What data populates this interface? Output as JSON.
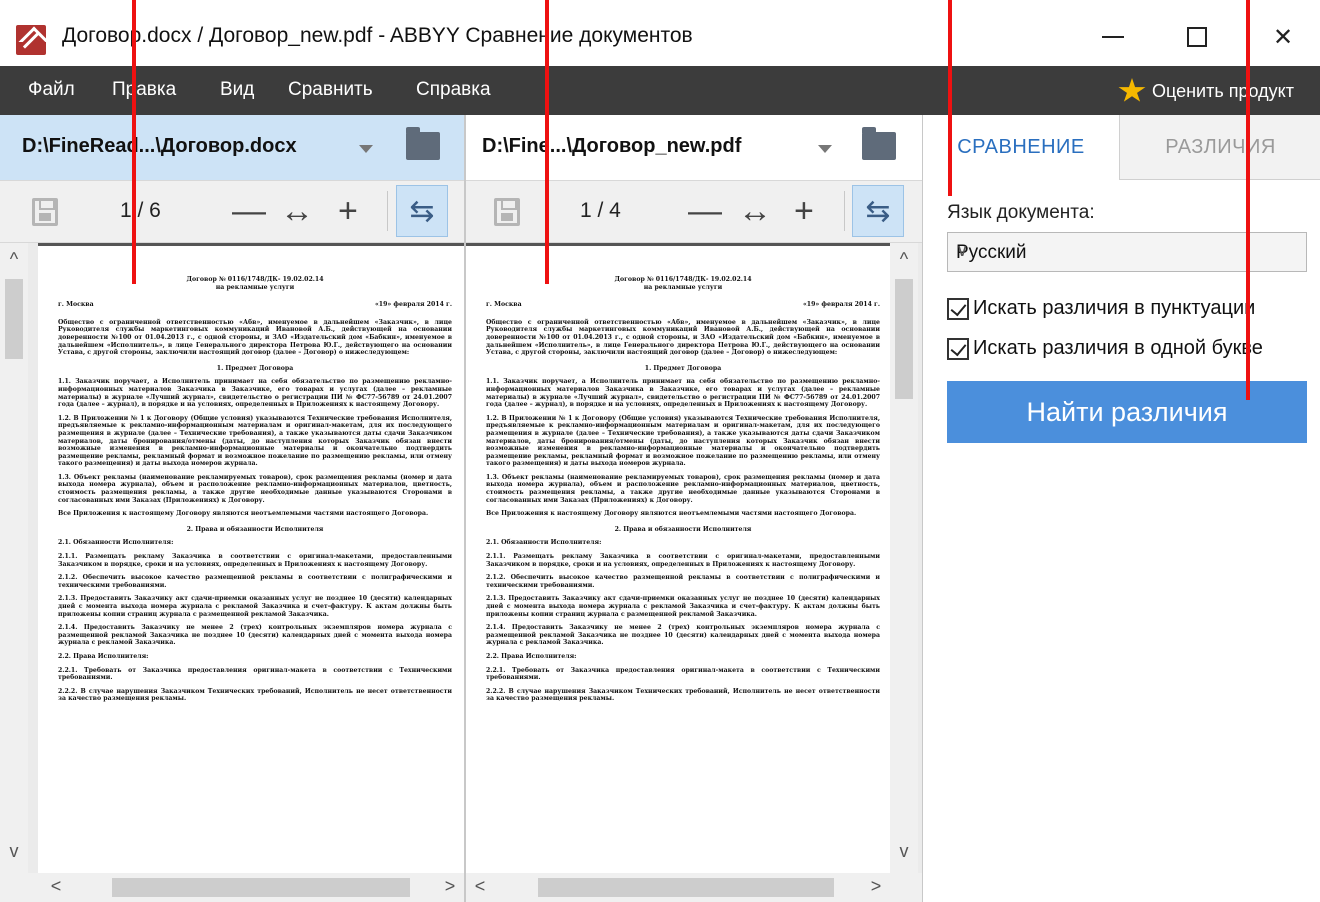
{
  "window": {
    "title": "Договор.docx / Договор_new.pdf - ABBYY Сравнение документов",
    "minimize_label": "",
    "close_glyph": "✕"
  },
  "menu": {
    "items": [
      "Файл",
      "Правка",
      "Вид",
      "Сравнить",
      "Справка"
    ],
    "rate_label": "Оценить продукт"
  },
  "left_pane": {
    "path": "D:\\FineRead...\\Договор.docx",
    "page_counter": "1 / 6"
  },
  "right_pane": {
    "path": "D:\\Fine...\\Договор_new.pdf",
    "page_counter": "1 / 4"
  },
  "toolbar": {
    "zoom_out": "—",
    "fit_width": "↔",
    "zoom_in": "+",
    "sync_glyph": "⇆"
  },
  "scroll": {
    "up": "^",
    "down": "v",
    "left": "<",
    "right": ">"
  },
  "document": {
    "title_line1": "Договор № 0116/1748/ДК- 19.02.02.14",
    "title_line2": "на рекламные услуги",
    "city": "г. Москва",
    "date": "«19» февраля 2014 г.",
    "intro": "Общество с ограниченной ответственностью «Абв», именуемое в дальнейшем «Заказчик», в лице Руководителя службы маркетинговых коммуникаций Ивановой А.Б., действующей на основании доверенности №100 от 01.04.2013 г., с одной стороны, и ЗАО «Издательский дом «Бабкин», именуемое в дальнейшем «Исполнитель», в лице Генерального директора Петрова Ю.Г., действующего на основании Устава, с другой стороны, заключили настоящий договор (далее – Договор) о нижеследующем:",
    "section1": "1. Предмет Договора",
    "p1_1": "1.1. Заказчик поручает, а Исполнитель принимает на себя обязательство по размещению рекламно-информационных материалов Заказчика в Заказчике, его товарах и услугах (далее – рекламные материалы) в журнале «Лучший журнал», свидетельство о регистрации ПИ № ФС77-56789 от 24.01.2007 года (далее – журнал), в порядке и на условиях, определенных в Приложениях к настоящему Договору.",
    "p1_2": "1.2. В Приложении № 1 к Договору (Общие условия) указываются Технические требования Исполнителя, предъявляемые к рекламно-информационным материалам и оригинал-макетам, для их последующего размещения в журнале (далее – Технические требования), а также указываются даты сдачи Заказчиком материалов, даты бронирования/отмены (даты, до наступления которых Заказчик обязан внести возможные изменения в рекламно-информационные материалы и окончательно подтвердить размещение рекламы, рекламный формат и возможное пожелание по размещению рекламы, или отмену такого размещения) и даты выхода номеров журнала.",
    "p1_3": "1.3. Объект рекламы (наименование рекламируемых товаров), срок размещения рекламы (номер и дата выхода номера журнала), объем и расположение рекламно-информационных материалов, цветность, стоимость размещения рекламы, а также другие необходимые данные указываются Сторонами в согласованных ими Заказах (Приложениях) к Договору.",
    "p1_4": "Все Приложения к настоящему Договору являются неотъемлемыми частями настоящего Договора.",
    "section2": "2. Права и обязанности Исполнителя",
    "p2_1": "2.1. Обязанности Исполнителя:",
    "p2_1_1": "2.1.1. Размещать рекламу Заказчика в соответствии с оригинал-макетами, предоставленными Заказчиком в порядке, сроки и на условиях, определенных в Приложениях к настоящему Договору.",
    "p2_1_2": "2.1.2. Обеспечить высокое качество размещенной рекламы в соответствии с полиграфическими и техническими требованиями.",
    "p2_1_3": "2.1.3. Предоставить Заказчику акт сдачи-приемки оказанных услуг не позднее 10 (десяти) календарных дней с момента выхода номера журнала с рекламой Заказчика и счет-фактуру. К актам должны быть приложены копии страниц журнала с размещенной рекламой Заказчика.",
    "p2_1_4": "2.1.4. Предоставить Заказчику не менее 2 (трех) контрольных экземпляров номера журнала с размещенной рекламой Заказчика не позднее 10 (десяти) календарных дней с момента выхода номера журнала с рекламой Заказчика.",
    "p2_2": "2.2. Права Исполнителя:",
    "p2_2_1": "2.2.1. Требовать от Заказчика предоставления оригинал-макета в соответствии с Техническими требованиями.",
    "p2_2_2": "2.2.2. В случае нарушения Заказчиком Технических требований, Исполнитель не несет ответственности за качество размещения рекламы."
  },
  "side_panel": {
    "tab_compare": "СРАВНЕНИЕ",
    "tab_differences": "РАЗЛИЧИЯ",
    "language_label": "Язык документа:",
    "language_value": "Русский",
    "option_punctuation": "Искать различия в пунктуации",
    "option_one_letter": "Искать различия в одной букве",
    "find_button": "Найти различия"
  },
  "colors": {
    "menubar": "#3c3c3c",
    "active_tab": "#2a6fbf",
    "find_button": "#4b8fdc",
    "annotation": "#ee1111",
    "logo": "#b0322f"
  }
}
